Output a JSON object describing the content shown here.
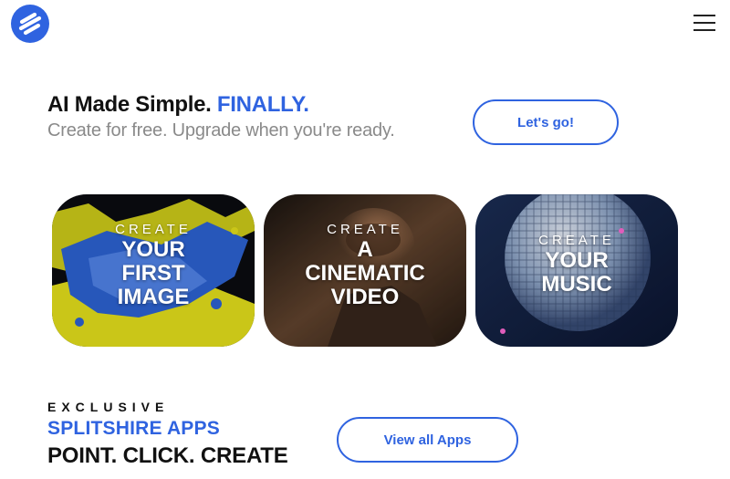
{
  "header": {
    "logo_icon": "splitshire-logo-icon",
    "menu_icon": "hamburger-menu-icon"
  },
  "hero": {
    "title_main": "AI Made Simple.",
    "title_accent": "FINALLY.",
    "subtitle": "Create for free. Upgrade when you're ready.",
    "cta_label": "Let's go!"
  },
  "cards": [
    {
      "kicker": "CREATE",
      "lines": [
        "YOUR",
        "FIRST",
        "IMAGE"
      ]
    },
    {
      "kicker": "CREATE",
      "lines": [
        "A",
        "CINEMATIC",
        "VIDEO"
      ]
    },
    {
      "kicker": "CREATE",
      "lines": [
        "YOUR",
        "MUSIC"
      ]
    }
  ],
  "apps": {
    "eyebrow": "EXCLUSIVE",
    "title": "SPLITSHIRE APPS",
    "tagline": "POINT. CLICK. CREATE",
    "cta_label": "View all Apps"
  },
  "colors": {
    "accent": "#2f63e0",
    "muted_text": "#8a8a8a",
    "card1_primary": "#e6e21c",
    "card1_secondary": "#2d64d4"
  }
}
